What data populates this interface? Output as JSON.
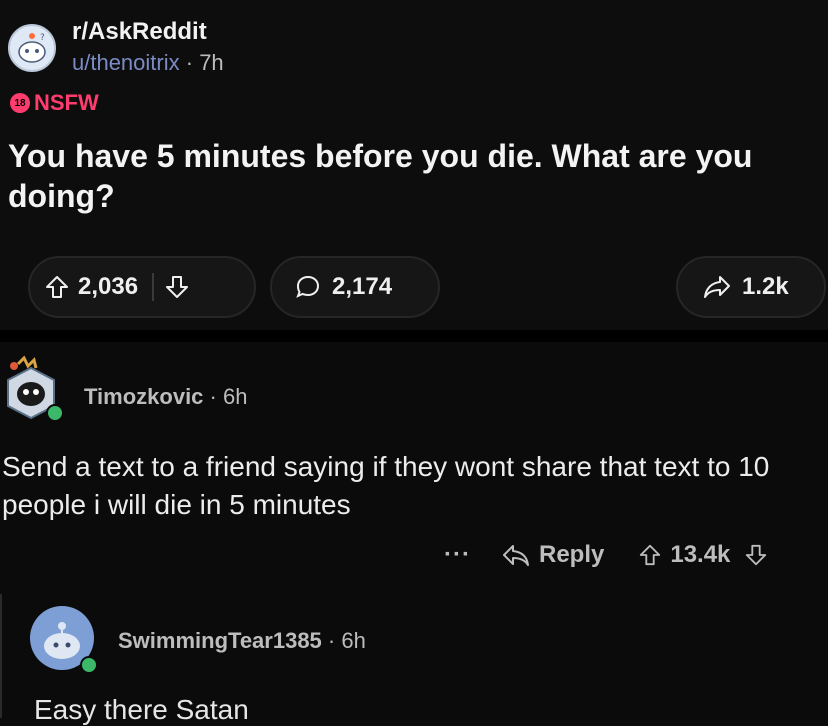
{
  "post": {
    "subreddit": "r/AskReddit",
    "author": "u/thenoitrix",
    "age": "· 7h",
    "nsfw_badge": "18",
    "nsfw_label": "NSFW",
    "title": "You have 5 minutes before you die. What are you doing?",
    "upvotes": "2,036",
    "comments": "2,174",
    "shares": "1.2k"
  },
  "comments": [
    {
      "author": "Timozkovic",
      "age": "· 6h",
      "body": "Send a text to a friend saying if they wont share that text to 10 people i will die in 5 minutes",
      "more": "···",
      "reply_label": "Reply",
      "votes": "13.4k"
    },
    {
      "author": "SwimmingTear1385",
      "age": "· 6h",
      "body": "Easy there Satan"
    }
  ],
  "colors": {
    "nsfw": "#ff3c6e",
    "username_link": "#7b8cc4",
    "online_dot": "#3cb86a"
  },
  "icons": [
    "upvote-icon",
    "downvote-icon",
    "comment-bubble-icon",
    "share-arrow-icon",
    "reply-arrow-icon",
    "more-dots-icon"
  ]
}
